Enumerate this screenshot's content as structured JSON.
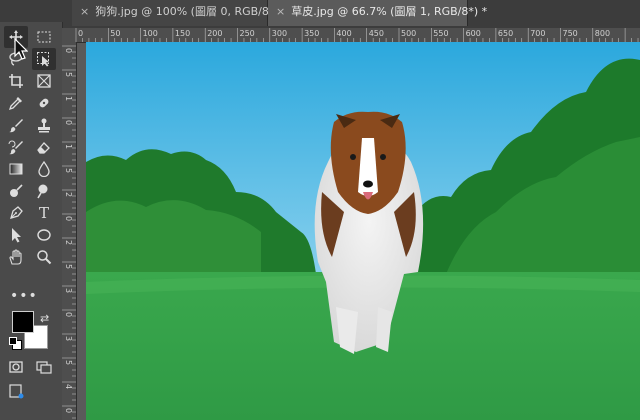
{
  "tabs": [
    {
      "close": "×",
      "label": "狗狗.jpg @ 100% (圖層 0, RGB/8#) *"
    },
    {
      "close": "×",
      "label": "草皮.jpg @ 66.7% (圖層 1, RGB/8*) *"
    }
  ],
  "tools": [
    {
      "name": "move-tool",
      "icon": "move-icon"
    },
    {
      "name": "marquee-tool",
      "icon": "rectangular-marquee-icon"
    },
    {
      "name": "lasso-tool",
      "icon": "lasso-icon"
    },
    {
      "name": "object-selection-tool",
      "icon": "object-selection-icon"
    },
    {
      "name": "crop-tool",
      "icon": "crop-icon"
    },
    {
      "name": "frame-tool",
      "icon": "frame-icon"
    },
    {
      "name": "eyedropper-tool",
      "icon": "eyedropper-icon"
    },
    {
      "name": "healing-brush-tool",
      "icon": "healing-brush-icon"
    },
    {
      "name": "brush-tool",
      "icon": "brush-icon"
    },
    {
      "name": "clone-stamp-tool",
      "icon": "stamp-icon"
    },
    {
      "name": "history-brush-tool",
      "icon": "history-brush-icon"
    },
    {
      "name": "eraser-tool",
      "icon": "eraser-icon"
    },
    {
      "name": "gradient-tool",
      "icon": "gradient-icon"
    },
    {
      "name": "blur-tool",
      "icon": "blur-drop-icon"
    },
    {
      "name": "dodge-tool",
      "icon": "dodge-icon"
    },
    {
      "name": "burn-tool",
      "icon": "burn-icon"
    },
    {
      "name": "pen-tool",
      "icon": "pen-icon"
    },
    {
      "name": "type-tool",
      "icon": "type-icon"
    },
    {
      "name": "path-selection-tool",
      "icon": "arrow-icon"
    },
    {
      "name": "ellipse-tool",
      "icon": "ellipse-icon"
    },
    {
      "name": "hand-tool",
      "icon": "hand-icon"
    },
    {
      "name": "zoom-tool",
      "icon": "zoom-icon"
    }
  ],
  "toolbar": {
    "more": "•••",
    "swap": "⇄",
    "type_glyph": "T"
  },
  "ruler": {
    "h_labels": [
      "0",
      "50",
      "100",
      "150",
      "200",
      "250",
      "300",
      "350",
      "400",
      "450",
      "500",
      "550",
      "600",
      "650",
      "700",
      "750",
      "800"
    ],
    "v_labels": [
      "0",
      "5",
      "1",
      "0",
      "1",
      "5",
      "2",
      "0",
      "2",
      "5",
      "3",
      "0",
      "3",
      "5",
      "4",
      "0"
    ]
  },
  "colors": {
    "foreground": "#000000",
    "background": "#ffffff",
    "sky": "#3fb1dc",
    "grass": "#35a34a",
    "trees": "#1f7a2c"
  }
}
